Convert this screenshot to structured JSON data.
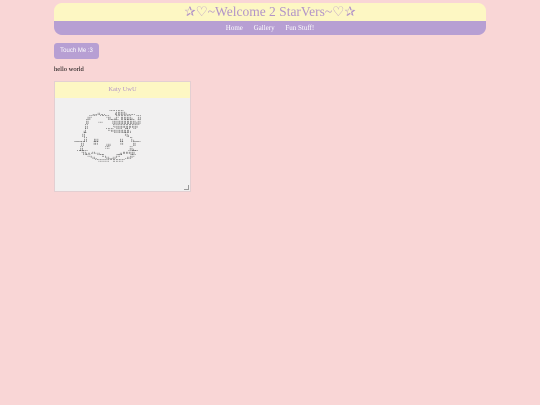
{
  "header": {
    "title": "✰♡~Welcome 2 StarVers~♡✰",
    "nav": [
      "Home",
      "Gallery",
      "Fun Stuff!"
    ]
  },
  "button": {
    "label": "Touch Me :3"
  },
  "hello_text": "hello world",
  "card": {
    "title": "Katy UwU",
    "ascii": "                 ⣀⣀\n          ⢀⣀⣤⣀⡀   ⣼⣿⣿⣦⣀⣀⡀\n        ⢰⡟⠉⠁⠈⠉⠙⣷⡀⣼⠋⣿⣿⣿⣧⡀⢹⡇\n        ⣿   ⠠⠤   ⢹⣿⣷⣶⣾⣿⣿⣷⣼⡇\n       ⢸⡇         ⠻⣿⣿⠿⣿⡿⢿⡿⠁\n       ⣼       ⠈⠛⠿⣶⣶⣶⣾⣷⡄\n      ⢰⡏              ⠹⣧\n   ⢀⣀⣀⣸⡇  ⣶⡆       ⢰⡆  ⢹⣄⣀\n   ⠈⠉⢹⡏   ⠿⠇  ⢠⣤   ⠸⠇   ⣿⠉⠁\n    ⢀⣸⣇⣀      ⠘⠛       ⣸⣧⡀\n     ⠈⢻⣦⠤⠴⠦⣤⣀     ⣀⣤⠶⠶⢶⡿⠉\n        ⠙⠳⣤⡀⠈⠛⢦⣄⣠⡴⠛⠁⢀⣤⡾⠋\n           ⠈⠙⠛⠛⠛⠉⠛⠛⠛⠋"
  }
}
